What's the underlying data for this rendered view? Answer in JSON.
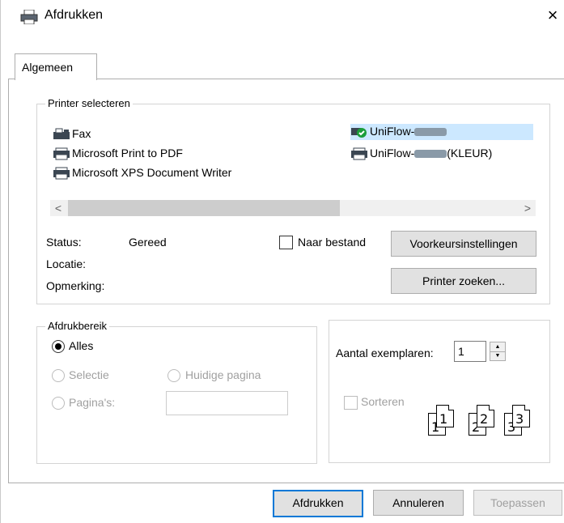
{
  "window": {
    "title": "Afdrukken",
    "close_symbol": "×"
  },
  "tabs": [
    {
      "label": "Algemeen",
      "selected": true
    }
  ],
  "printer_group": {
    "legend": "Printer selecteren",
    "printers": [
      {
        "name": "Fax",
        "icon": "fax-icon",
        "selected": false
      },
      {
        "name": "UniFlow-",
        "icon": "printer-default-icon",
        "selected": true
      },
      {
        "name": "Microsoft Print to PDF",
        "icon": "printer-icon",
        "selected": false
      },
      {
        "name": "UniFlow-",
        "suffix": "(KLEUR)",
        "icon": "printer-icon",
        "selected": false
      },
      {
        "name": "Microsoft XPS Document Writer",
        "icon": "printer-icon",
        "selected": false
      }
    ],
    "scroll_left": "<",
    "scroll_right": ">",
    "status_label": "Status:",
    "status_value": "Gereed",
    "location_label": "Locatie:",
    "comment_label": "Opmerking:",
    "print_to_file_label": "Naar bestand",
    "print_to_file_checked": false,
    "preferences_button": "Voorkeursinstellingen",
    "find_printer_button": "Printer zoeken..."
  },
  "range_group": {
    "legend": "Afdrukbereik",
    "all_label": "Alles",
    "selection_label": "Selectie",
    "current_page_label": "Huidige pagina",
    "pages_label": "Pagina's:",
    "pages_value": "",
    "selected": "all"
  },
  "copies_group": {
    "copies_label": "Aantal exemplaren:",
    "copies_value": "1",
    "collate_label": "Sorteren",
    "collate_checked": false,
    "collate_pages": [
      "1",
      "1",
      "2",
      "2",
      "3",
      "3"
    ]
  },
  "footer": {
    "print_button": "Afdrukken",
    "cancel_button": "Annuleren",
    "apply_button": "Toepassen"
  },
  "colors": {
    "selection": "#cce8ff",
    "accent": "#0078d7",
    "shield": "#1a9e3a"
  }
}
